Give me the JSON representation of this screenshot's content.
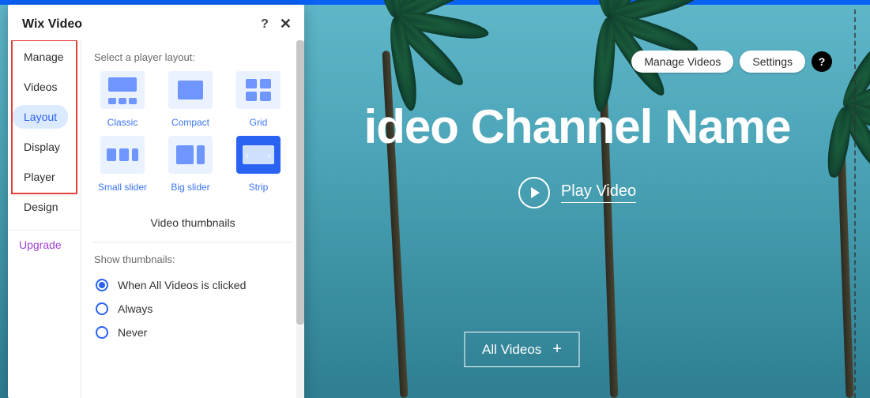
{
  "panel": {
    "title": "Wix Video",
    "nav": [
      "Manage",
      "Videos",
      "Layout",
      "Display",
      "Player",
      "Design"
    ],
    "nav_active_index": 2,
    "upgrade": "Upgrade",
    "select_label": "Select a player layout:",
    "layouts": [
      "Classic",
      "Compact",
      "Grid",
      "Small slider",
      "Big slider",
      "Strip"
    ],
    "layouts_selected_index": 5,
    "thumbnails_title": "Video thumbnails",
    "thumbnails_label": "Show thumbnails:",
    "thumbnail_options": [
      "When All Videos is clicked",
      "Always",
      "Never"
    ],
    "thumbnail_selected_index": 0
  },
  "canvas": {
    "channel_name": "ideo Channel Name",
    "play_label": "Play Video",
    "all_videos_label": "All Videos",
    "manage_videos": "Manage Videos",
    "settings": "Settings"
  },
  "icons": {
    "help": "?",
    "close": "✕",
    "plus": "+"
  }
}
